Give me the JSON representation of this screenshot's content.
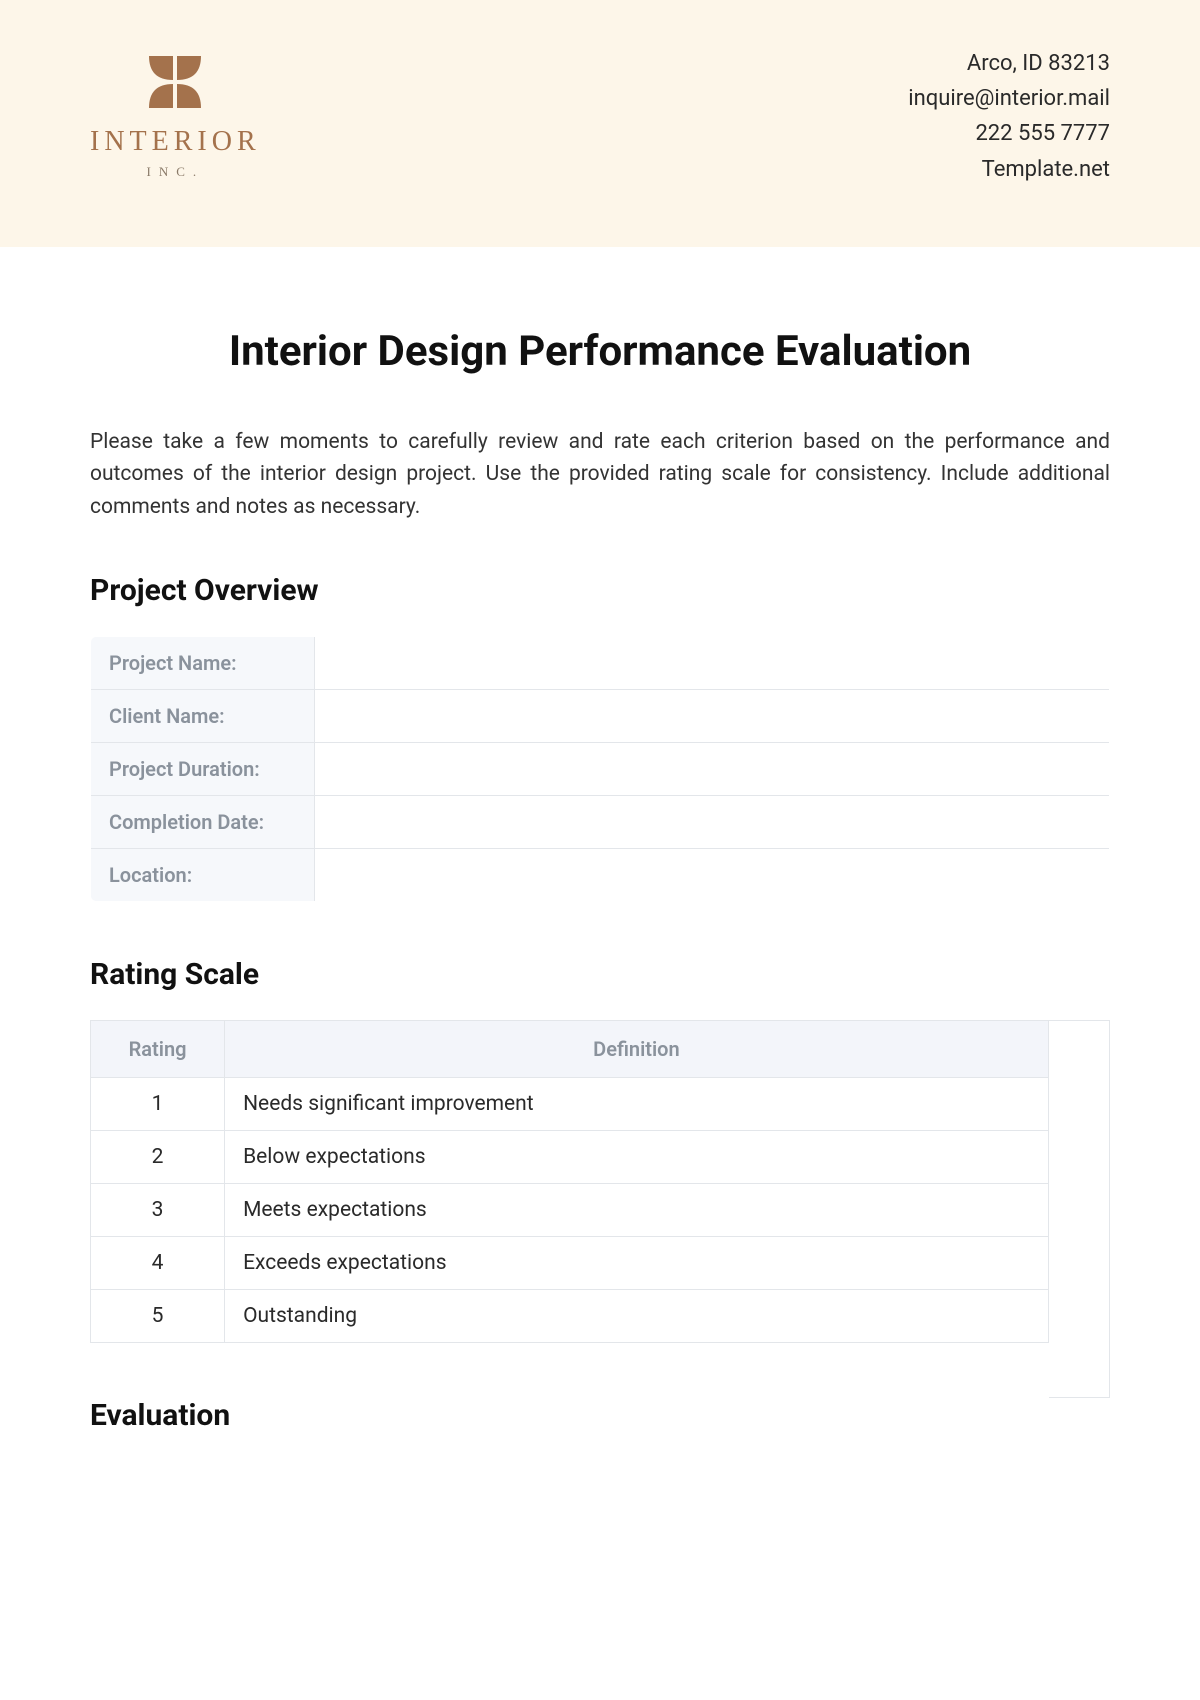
{
  "header": {
    "logo": {
      "name": "INTERIOR",
      "sub": "INC."
    },
    "contact": {
      "address": "Arco, ID 83213",
      "email": "inquire@interior.mail",
      "phone": "222 555 7777",
      "site": "Template.net"
    }
  },
  "title": "Interior Design Performance Evaluation",
  "intro": "Please take a few moments to carefully review and rate each criterion based on the performance and outcomes of the interior design project. Use the provided rating scale for consistency. Include additional comments and notes as necessary.",
  "sections": {
    "overview_title": "Project Overview",
    "rating_title": "Rating Scale",
    "evaluation_title": "Evaluation"
  },
  "overview": {
    "rows": [
      {
        "label": "Project Name:",
        "value": ""
      },
      {
        "label": "Client Name:",
        "value": ""
      },
      {
        "label": "Project Duration:",
        "value": ""
      },
      {
        "label": "Completion Date:",
        "value": ""
      },
      {
        "label": "Location:",
        "value": ""
      }
    ]
  },
  "rating_scale": {
    "headers": {
      "rating": "Rating",
      "definition": "Definition"
    },
    "rows": [
      {
        "rating": "1",
        "definition": "Needs significant improvement"
      },
      {
        "rating": "2",
        "definition": "Below expectations"
      },
      {
        "rating": "3",
        "definition": "Meets expectations"
      },
      {
        "rating": "4",
        "definition": "Exceeds expectations"
      },
      {
        "rating": "5",
        "definition": "Outstanding"
      }
    ]
  },
  "colors": {
    "header_bg": "#fdf6e9",
    "brand": "#a4724c",
    "table_header_bg": "#f3f5fa",
    "label_text": "#8a929c",
    "border": "#e3e6ea"
  }
}
